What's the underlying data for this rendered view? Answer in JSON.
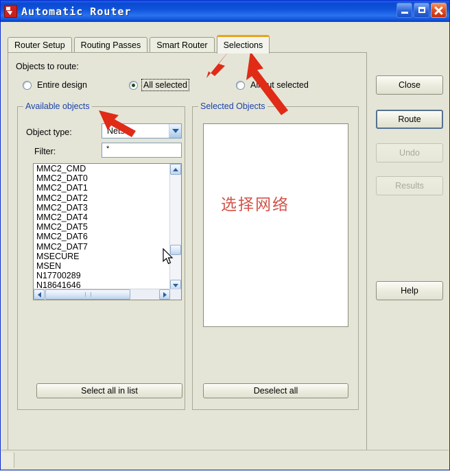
{
  "window": {
    "title": "Automatic Router",
    "icon": "app-icon",
    "controls": {
      "minimize": "minimize",
      "maximize": "maximize",
      "close": "close"
    }
  },
  "tabs": [
    {
      "label": "Router Setup",
      "active": false
    },
    {
      "label": "Routing Passes",
      "active": false
    },
    {
      "label": "Smart Router",
      "active": false
    },
    {
      "label": "Selections",
      "active": true
    }
  ],
  "main": {
    "objects_to_route_label": "Objects to route:",
    "radios": [
      {
        "label": "Entire design",
        "checked": false,
        "focused": false
      },
      {
        "label": "All selected",
        "checked": true,
        "focused": true
      },
      {
        "label": "All but selected",
        "checked": false,
        "focused": false
      }
    ],
    "available_group": {
      "title": "Available objects",
      "object_type_label": "Object type:",
      "object_type_value": "Nets",
      "filter_label": "Filter:",
      "filter_value": "*",
      "items": [
        "MMC2_CMD",
        "MMC2_DAT0",
        "MMC2_DAT1",
        "MMC2_DAT2",
        "MMC2_DAT3",
        "MMC2_DAT4",
        "MMC2_DAT5",
        "MMC2_DAT6",
        "MMC2_DAT7",
        "MSECURE",
        "MSEN",
        "N17700289",
        "N18641646"
      ],
      "select_all_button": "Select all in list"
    },
    "selected_group": {
      "title": "Selected Objects",
      "items": [],
      "deselect_all_button": "Deselect all",
      "annotation": "选择网络"
    }
  },
  "side_buttons": [
    {
      "label": "Close",
      "enabled": true,
      "default": false
    },
    {
      "label": "Route",
      "enabled": true,
      "default": true
    },
    {
      "label": "Undo",
      "enabled": false,
      "default": false
    },
    {
      "label": "Results",
      "enabled": false,
      "default": false
    },
    {
      "label": "Help",
      "enabled": true,
      "default": false
    }
  ],
  "statusbar": {
    "text": ""
  },
  "colors": {
    "titlebar_blue": "#0b49d0",
    "dialog_face": "#e4e5d7",
    "group_title_blue": "#1c42a8",
    "active_tab_accent": "#e8a317",
    "annotation_red": "#d2544a",
    "arrow_red": "#e02b17"
  }
}
